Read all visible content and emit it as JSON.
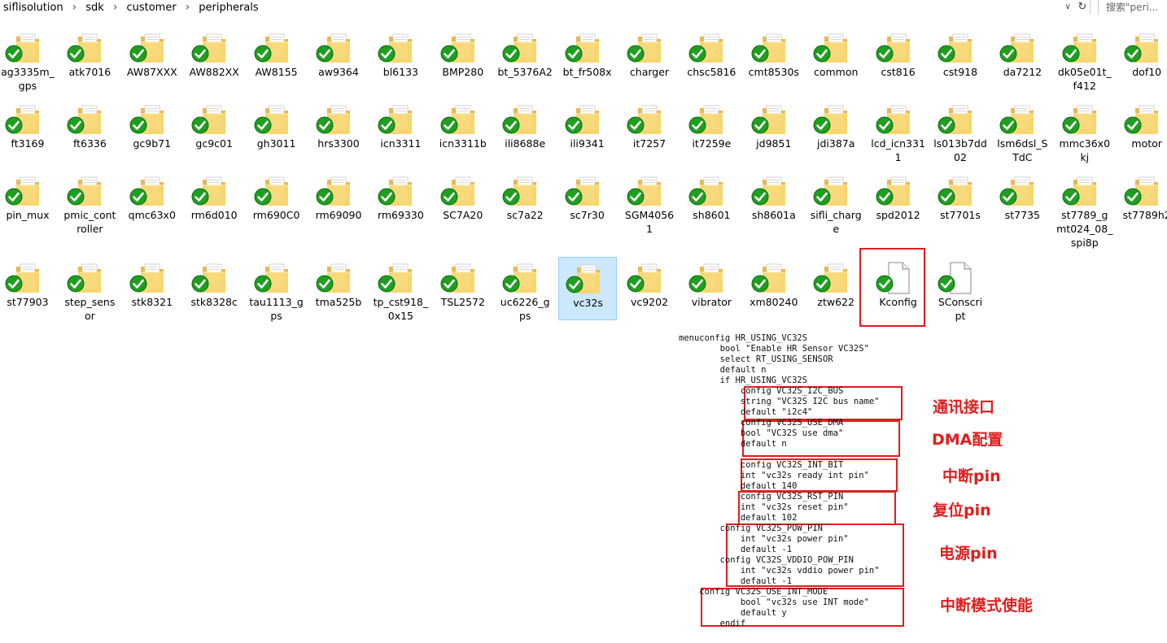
{
  "address_bar": {
    "breadcrumbs": [
      "siflisolution",
      "sdk",
      "customer",
      "peripherals"
    ],
    "search_placeholder": "搜索\"peri..."
  },
  "items": [
    {
      "name": "ag3335m_gps",
      "label": "ag3335m_\ngps",
      "type": "folder"
    },
    {
      "name": "atk7016",
      "label": "atk7016",
      "type": "folder"
    },
    {
      "name": "AW87XXX",
      "label": "AW87XXX",
      "type": "folder"
    },
    {
      "name": "AW882XX",
      "label": "AW882XX",
      "type": "folder"
    },
    {
      "name": "AW8155",
      "label": "AW8155",
      "type": "folder"
    },
    {
      "name": "aw9364",
      "label": "aw9364",
      "type": "folder"
    },
    {
      "name": "bl6133",
      "label": "bl6133",
      "type": "folder"
    },
    {
      "name": "BMP280",
      "label": "BMP280",
      "type": "folder"
    },
    {
      "name": "bt_5376A2",
      "label": "bt_5376A2",
      "type": "folder"
    },
    {
      "name": "bt_fr508x",
      "label": "bt_fr508x",
      "type": "folder"
    },
    {
      "name": "charger",
      "label": "charger",
      "type": "folder"
    },
    {
      "name": "chsc5816",
      "label": "chsc5816",
      "type": "folder"
    },
    {
      "name": "cmt8530s",
      "label": "cmt8530s",
      "type": "folder"
    },
    {
      "name": "common",
      "label": "common",
      "type": "folder"
    },
    {
      "name": "cst816",
      "label": "cst816",
      "type": "folder"
    },
    {
      "name": "cst918",
      "label": "cst918",
      "type": "folder"
    },
    {
      "name": "da7212",
      "label": "da7212",
      "type": "folder"
    },
    {
      "name": "dk05e01t_f412",
      "label": "dk05e01t_\nf412",
      "type": "folder"
    },
    {
      "name": "dof10",
      "label": "dof10",
      "type": "folder"
    },
    {
      "name": "ft3169",
      "label": "ft3169",
      "type": "folder"
    },
    {
      "name": "ft6336",
      "label": "ft6336",
      "type": "folder"
    },
    {
      "name": "gc9b71",
      "label": "gc9b71",
      "type": "folder"
    },
    {
      "name": "gc9c01",
      "label": "gc9c01",
      "type": "folder"
    },
    {
      "name": "gh3011",
      "label": "gh3011",
      "type": "folder"
    },
    {
      "name": "hrs3300",
      "label": "hrs3300",
      "type": "folder"
    },
    {
      "name": "icn3311",
      "label": "icn3311",
      "type": "folder"
    },
    {
      "name": "icn3311b",
      "label": "icn3311b",
      "type": "folder"
    },
    {
      "name": "ili8688e",
      "label": "ili8688e",
      "type": "folder"
    },
    {
      "name": "ili9341",
      "label": "ili9341",
      "type": "folder"
    },
    {
      "name": "it7257",
      "label": "it7257",
      "type": "folder"
    },
    {
      "name": "it7259e",
      "label": "it7259e",
      "type": "folder"
    },
    {
      "name": "jd9851",
      "label": "jd9851",
      "type": "folder"
    },
    {
      "name": "jdi387a",
      "label": "jdi387a",
      "type": "folder"
    },
    {
      "name": "lcd_icn3311",
      "label": "lcd_icn331\n1",
      "type": "folder"
    },
    {
      "name": "ls013b7dd02",
      "label": "ls013b7dd\n02",
      "type": "folder"
    },
    {
      "name": "lsm6dsl_STdC",
      "label": "lsm6dsl_S\nTdC",
      "type": "folder"
    },
    {
      "name": "mmc36x0kj",
      "label": "mmc36x0\nkj",
      "type": "folder"
    },
    {
      "name": "motor",
      "label": "motor",
      "type": "folder"
    },
    {
      "name": "pin_mux",
      "label": "pin_mux",
      "type": "folder"
    },
    {
      "name": "pmic_controller",
      "label": "pmic_cont\nroller",
      "type": "folder"
    },
    {
      "name": "qmc63x0",
      "label": "qmc63x0",
      "type": "folder"
    },
    {
      "name": "rm6d010",
      "label": "rm6d010",
      "type": "folder"
    },
    {
      "name": "rm690C0",
      "label": "rm690C0",
      "type": "folder"
    },
    {
      "name": "rm69090",
      "label": "rm69090",
      "type": "folder"
    },
    {
      "name": "rm69330",
      "label": "rm69330",
      "type": "folder"
    },
    {
      "name": "SC7A20",
      "label": "SC7A20",
      "type": "folder"
    },
    {
      "name": "sc7a22",
      "label": "sc7a22",
      "type": "folder"
    },
    {
      "name": "sc7r30",
      "label": "sc7r30",
      "type": "folder"
    },
    {
      "name": "SGM40561",
      "label": "SGM4056\n1",
      "type": "folder"
    },
    {
      "name": "sh8601",
      "label": "sh8601",
      "type": "folder"
    },
    {
      "name": "sh8601a",
      "label": "sh8601a",
      "type": "folder"
    },
    {
      "name": "sifli_charge",
      "label": "sifli_charg\ne",
      "type": "folder"
    },
    {
      "name": "spd2012",
      "label": "spd2012",
      "type": "folder"
    },
    {
      "name": "st7701s",
      "label": "st7701s",
      "type": "folder"
    },
    {
      "name": "st7735",
      "label": "st7735",
      "type": "folder"
    },
    {
      "name": "st7789_gmt024_08_spi8p",
      "label": "st7789_g\nmt024_08_\nspi8p",
      "type": "folder"
    },
    {
      "name": "st7789h2",
      "label": "st7789h2",
      "type": "folder"
    },
    {
      "name": "st77903",
      "label": "st77903",
      "type": "folder"
    },
    {
      "name": "step_sensor",
      "label": "step_sens\nor",
      "type": "folder"
    },
    {
      "name": "stk8321",
      "label": "stk8321",
      "type": "folder"
    },
    {
      "name": "stk8328c",
      "label": "stk8328c",
      "type": "folder"
    },
    {
      "name": "tau1113_gps",
      "label": "tau1113_g\nps",
      "type": "folder"
    },
    {
      "name": "tma525b",
      "label": "tma525b",
      "type": "folder"
    },
    {
      "name": "tp_cst918_0x15",
      "label": "tp_cst918_\n0x15",
      "type": "folder"
    },
    {
      "name": "TSL2572",
      "label": "TSL2572",
      "type": "folder"
    },
    {
      "name": "uc6226_gps",
      "label": "uc6226_g\nps",
      "type": "folder"
    },
    {
      "name": "vc32s",
      "label": "vc32s",
      "type": "folder",
      "selected": true
    },
    {
      "name": "vc9202",
      "label": "vc9202",
      "type": "folder"
    },
    {
      "name": "vibrator",
      "label": "vibrator",
      "type": "folder"
    },
    {
      "name": "xm80240",
      "label": "xm80240",
      "type": "folder"
    },
    {
      "name": "ztw622",
      "label": "ztw622",
      "type": "folder"
    },
    {
      "name": "Kconfig",
      "label": "Kconfig",
      "type": "file",
      "highlighted": true
    },
    {
      "name": "SConscript",
      "label": "SConscri\npt",
      "type": "file"
    }
  ],
  "kconfig_code": "menuconfig HR_USING_VC32S\n        bool \"Enable HR Sensor VC32S\"\n        select RT_USING_SENSOR\n        default n\n        if HR_USING_VC32S\n            config VC32S_I2C_BUS\n            string \"VC32S I2C bus name\"\n            default \"i2c4\"\n            config VC32S_USE_DMA\n            bool \"VC32S use dma\"\n            default n\n\n            config VC32S_INT_BIT\n            int \"vc32s ready int pin\"\n            default 140\n            config VC32S_RST_PIN\n            int \"vc32s reset pin\"\n            default 102\n        config VC32S_POW_PIN\n            int \"vc32s power pin\"\n            default -1\n        config VC32S_VDDIO_POW_PIN\n            int \"vc32s vddio power pin\"\n            default -1\n    config VC32S_USE_INT_MODE\n            bool \"vc32s use INT mode\"\n            default y\n        endif",
  "annotations": [
    {
      "name": "comm-interface",
      "text": "通讯接口"
    },
    {
      "name": "dma-config",
      "text": "DMA配置"
    },
    {
      "name": "interrupt-pin",
      "text": "中断pin"
    },
    {
      "name": "reset-pin",
      "text": "复位pin"
    },
    {
      "name": "power-pin",
      "text": "电源pin"
    },
    {
      "name": "interrupt-mode-enable",
      "text": "中断模式使能"
    }
  ],
  "colors": {
    "highlight_red": "#e11d1d",
    "selection_bg": "#cce8ff",
    "folder_yellow": "#f8d775",
    "sync_check_green": "#1f9e1f"
  }
}
